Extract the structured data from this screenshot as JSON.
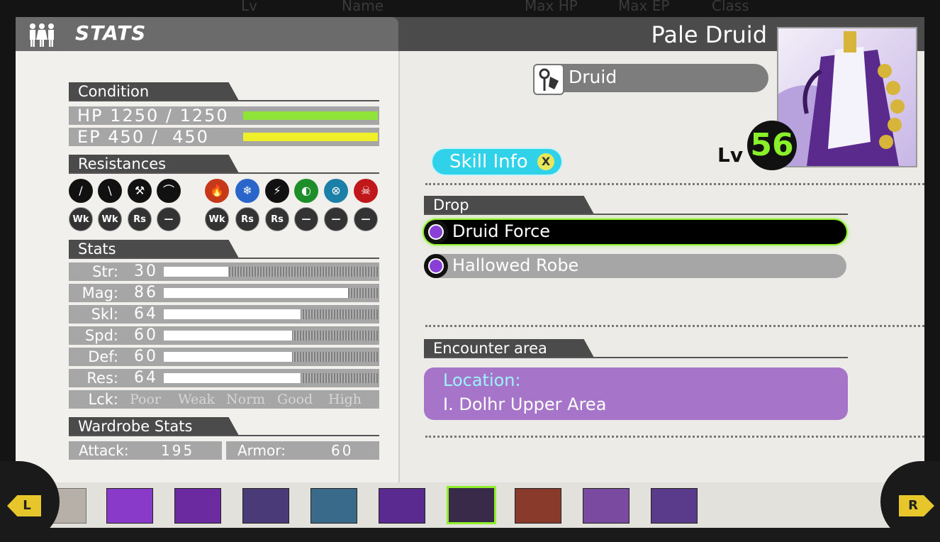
{
  "background_header": {
    "lv": "Lv",
    "name": "Name",
    "max_hp": "Max HP",
    "max_ep": "Max EP",
    "class": "Class"
  },
  "left_panel": {
    "title": "STATS",
    "condition": {
      "heading": "Condition",
      "hp_label": "HP",
      "hp_value": "1250 / 1250",
      "hp_fraction": 1.0,
      "ep_label": "EP",
      "ep_value": "450 /  450",
      "ep_fraction": 1.0
    },
    "resistances": {
      "heading": "Resistances",
      "items": [
        {
          "icon": "sword-icon",
          "value": "Wk"
        },
        {
          "icon": "staff-icon",
          "value": "Wk"
        },
        {
          "icon": "axe-icon",
          "value": "Rs"
        },
        {
          "icon": "bow-icon",
          "value": "—"
        },
        {
          "icon": "fire-icon",
          "value": "Wk"
        },
        {
          "icon": "ice-icon",
          "value": "Rs"
        },
        {
          "icon": "lightning-icon",
          "value": "Rs"
        },
        {
          "icon": "wind-icon",
          "value": "—"
        },
        {
          "icon": "dark-icon",
          "value": "—"
        },
        {
          "icon": "death-icon",
          "value": "—"
        }
      ]
    },
    "stats": {
      "heading": "Stats",
      "rows": [
        {
          "label": "Str:",
          "value": "30",
          "fraction": 0.3
        },
        {
          "label": "Mag:",
          "value": "86",
          "fraction": 0.86
        },
        {
          "label": "Skl:",
          "value": "64",
          "fraction": 0.64
        },
        {
          "label": "Spd:",
          "value": "60",
          "fraction": 0.6
        },
        {
          "label": "Def:",
          "value": "60",
          "fraction": 0.6
        },
        {
          "label": "Res:",
          "value": "64",
          "fraction": 0.64
        }
      ],
      "luck_label": "Lck:",
      "luck_scale": [
        "Poor",
        "Weak",
        "Norm",
        "Good",
        "High"
      ]
    },
    "wardrobe": {
      "heading": "Wardrobe Stats",
      "attack_label": "Attack:",
      "attack_value": "195",
      "armor_label": "Armor:",
      "armor_value": "60"
    }
  },
  "right_panel": {
    "name": "Pale Druid",
    "class": "Druid",
    "level_label": "Lv",
    "level": "56",
    "skill_info_button": "Skill Info",
    "skill_info_key": "X",
    "drop": {
      "heading": "Drop",
      "items": [
        {
          "label": "Druid Force",
          "selected": true
        },
        {
          "label": "Hallowed Robe",
          "selected": false
        }
      ]
    },
    "encounter": {
      "heading": "Encounter area",
      "location_label": "Location:",
      "location_value": "I. Dolhr Upper Area"
    }
  },
  "roster": {
    "prev_button": "L",
    "next_button": "R",
    "selected_index": 6,
    "count": 10
  },
  "colors": {
    "hp_bar": "#8fe43a",
    "ep_bar": "#f0f02a",
    "selected_drop_glow": "#8fef2a",
    "location_box": "#a674c8",
    "skill_button": "#2fd2e8",
    "level_number": "#8af02a"
  }
}
